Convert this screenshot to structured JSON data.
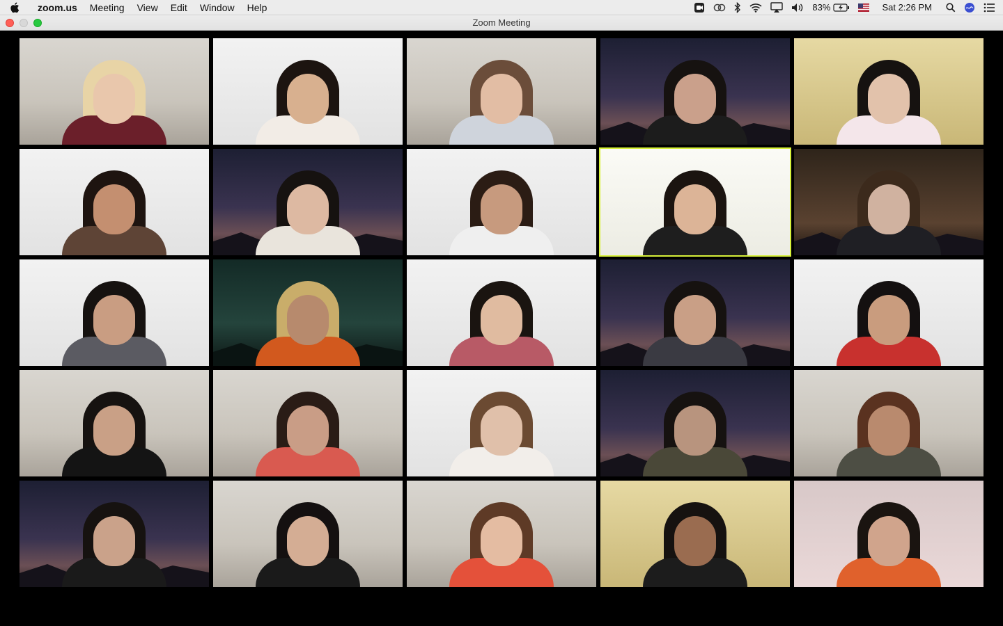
{
  "menubar": {
    "app_name": "zoom.us",
    "items": [
      "Meeting",
      "View",
      "Edit",
      "Window",
      "Help"
    ],
    "battery": "83%",
    "clock": "Sat 2:26 PM"
  },
  "window": {
    "title": "Zoom Meeting"
  },
  "gallery": {
    "active_speaker_tile": 9,
    "tiles": [
      {
        "bg": "bg-room",
        "hair": "#e8d4a6",
        "skin": "#e9c7ac",
        "top": "#6b1f2a"
      },
      {
        "bg": "bg-white",
        "hair": "#1c1410",
        "skin": "#d8b08f",
        "top": "#f2ece6"
      },
      {
        "bg": "bg-room",
        "hair": "#6b4d3a",
        "skin": "#e2bda4",
        "top": "#cfd4dc"
      },
      {
        "bg": "bg-night",
        "hair": "#161210",
        "skin": "#caa08b",
        "top": "#1c1c1c"
      },
      {
        "bg": "bg-yellow",
        "hair": "#161210",
        "skin": "#e2c2ab",
        "top": "#f4e6ea"
      },
      {
        "bg": "bg-white",
        "hair": "#1e1410",
        "skin": "#c48f70",
        "top": "#5e4436"
      },
      {
        "bg": "bg-night",
        "hair": "#161210",
        "skin": "#ddb9a2",
        "top": "#e9e4dc"
      },
      {
        "bg": "bg-white",
        "hair": "#2b1c14",
        "skin": "#c79a7e",
        "top": "#efefef"
      },
      {
        "bg": "bg-bright",
        "hair": "#1b1410",
        "skin": "#dcb497",
        "top": "#1e1e1e"
      },
      {
        "bg": "bg-brown",
        "hair": "#3c2a1c",
        "skin": "#d0b2a0",
        "top": "#1f1f24"
      },
      {
        "bg": "bg-white",
        "hair": "#161210",
        "skin": "#c99d82",
        "top": "#5b5b62"
      },
      {
        "bg": "bg-green",
        "hair": "#c9ad6a",
        "skin": "#b78a6d",
        "top": "#d2591e"
      },
      {
        "bg": "bg-white",
        "hair": "#1a1410",
        "skin": "#e0bba0",
        "top": "#b85a66"
      },
      {
        "bg": "bg-night",
        "hair": "#161210",
        "skin": "#c99f86",
        "top": "#3a3a42"
      },
      {
        "bg": "bg-white",
        "hair": "#141010",
        "skin": "#c99c7e",
        "top": "#c8312e"
      },
      {
        "bg": "bg-room",
        "hair": "#161210",
        "skin": "#c9a086",
        "top": "#141414"
      },
      {
        "bg": "bg-room",
        "hair": "#2a1c16",
        "skin": "#c99d86",
        "top": "#d95a50"
      },
      {
        "bg": "bg-white",
        "hair": "#6b4a32",
        "skin": "#e0c0aa",
        "top": "#f2eeea"
      },
      {
        "bg": "bg-night",
        "hair": "#161210",
        "skin": "#b8947e",
        "top": "#4a4838"
      },
      {
        "bg": "bg-room",
        "hair": "#5a3220",
        "skin": "#b98a6e",
        "top": "#4d4e44"
      },
      {
        "bg": "bg-night",
        "hair": "#161210",
        "skin": "#caa28a",
        "top": "#1a1a1a"
      },
      {
        "bg": "bg-room",
        "hair": "#141010",
        "skin": "#d4ad94",
        "top": "#1a1a1a"
      },
      {
        "bg": "bg-room",
        "hair": "#5e3a26",
        "skin": "#e4bca2",
        "top": "#e4513a"
      },
      {
        "bg": "bg-yellow",
        "hair": "#161210",
        "skin": "#9a6c50",
        "top": "#1c1c1c"
      },
      {
        "bg": "bg-pink",
        "hair": "#1a1410",
        "skin": "#d0a48c",
        "top": "#e0612c"
      }
    ]
  }
}
